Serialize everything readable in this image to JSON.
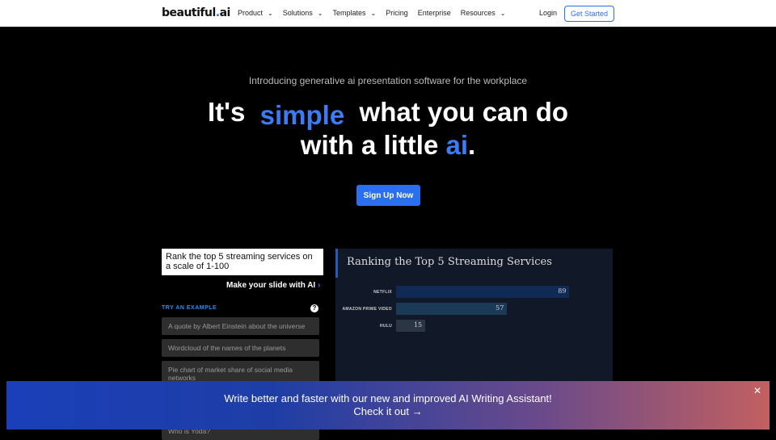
{
  "nav": {
    "logo": "beautiful",
    "logo_dot": ".",
    "logo_suffix": "ai",
    "items": [
      {
        "label": "Product",
        "dropdown": true
      },
      {
        "label": "Solutions",
        "dropdown": true
      },
      {
        "label": "Templates",
        "dropdown": true
      },
      {
        "label": "Pricing"
      },
      {
        "label": "Enterprise"
      },
      {
        "label": "Resources",
        "dropdown": true
      }
    ],
    "login": "Login",
    "get_started": "Get Started"
  },
  "hero": {
    "intro": "Introducing generative ai presentation software for the workplace",
    "line1a": "It's",
    "highlight": "simple",
    "line1b": "what you can do",
    "line2a": "with a little",
    "ai": "ai",
    "period": ".",
    "signup": "Sign Up Now"
  },
  "generator": {
    "prompt": "Rank the top 5 streaming services on a scale of 1-100",
    "make": "Make your slide with AI",
    "try_label": "TRY AN EXAMPLE",
    "examples": [
      "A quote by Albert Einstein about the universe",
      "Wordcloud of the names of the planets",
      "Pie chart of market share of social media networks",
      "Who is Yoda?"
    ]
  },
  "slide": {
    "title": "Ranking the Top 5 Streaming Services",
    "bars": [
      {
        "label": "NETFLIX",
        "value": 89,
        "color": "#0f2a55"
      },
      {
        "label": "AMAZON PRIME VIDEO",
        "value": 57,
        "color": "#1b3a58"
      },
      {
        "label": "HULU",
        "value": 15,
        "color": "#2a3644"
      }
    ],
    "max": 100
  },
  "banner": {
    "line1": "Write better and faster with our new and improved AI Writing Assistant!",
    "line2": "Check it out",
    "arrow": "→",
    "close": "✕"
  }
}
